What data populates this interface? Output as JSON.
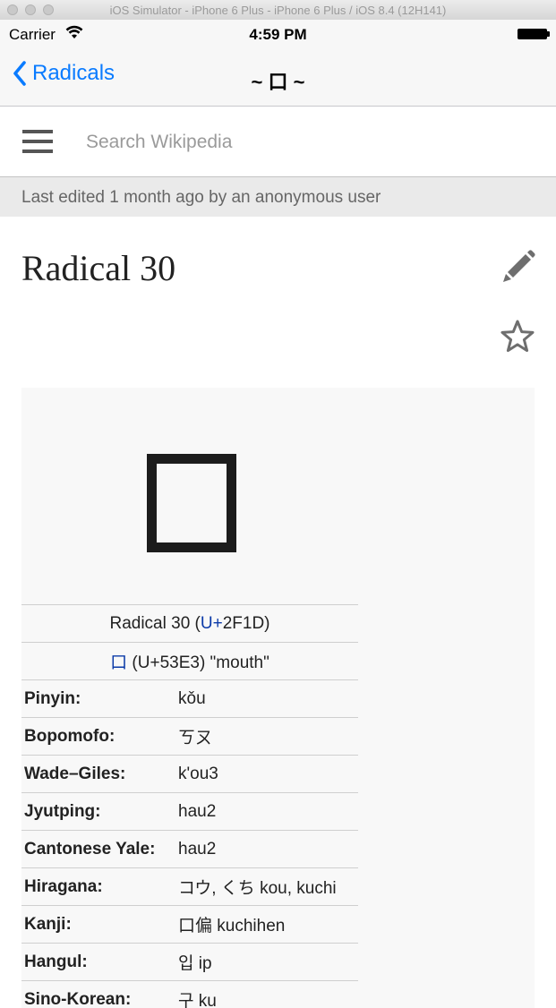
{
  "simulator": {
    "title": "iOS Simulator - iPhone 6 Plus - iPhone 6 Plus / iOS 8.4 (12H141)"
  },
  "status_bar": {
    "carrier": "Carrier",
    "time": "4:59 PM"
  },
  "nav": {
    "back_label": "Radicals",
    "title": "~ 口 ~"
  },
  "wiki": {
    "search_placeholder": "Search Wikipedia",
    "last_edited": "Last edited 1 month ago by an anonymous user",
    "page_title": "Radical 30"
  },
  "infobox": {
    "glyph": "口",
    "radical_prefix": "Radical 30 (",
    "radical_link": "U+",
    "radical_suffix": "2F1D)",
    "char_link": "口",
    "char_rest": " (U+53E3) \"mouth\"",
    "rows": [
      {
        "label": "Pinyin",
        "value": "kǒu"
      },
      {
        "label": "Bopomofo",
        "value": "ㄎㄡ"
      },
      {
        "label": "Wade–Giles",
        "value": "k'ou3"
      },
      {
        "label": "Jyutping",
        "value": "hau2"
      },
      {
        "label": "Cantonese Yale",
        "value": "hau2"
      },
      {
        "label": "Hiragana",
        "value": "コウ, くち kou, kuchi"
      },
      {
        "label": "Kanji",
        "value": "口偏 kuchihen"
      },
      {
        "label": "Hangul",
        "value": "입 ip"
      },
      {
        "label": "Sino-Korean",
        "value": "구 ku"
      }
    ]
  },
  "colors": {
    "ios_blue": "#0a7bff",
    "wiki_link": "#0b3aa8"
  }
}
